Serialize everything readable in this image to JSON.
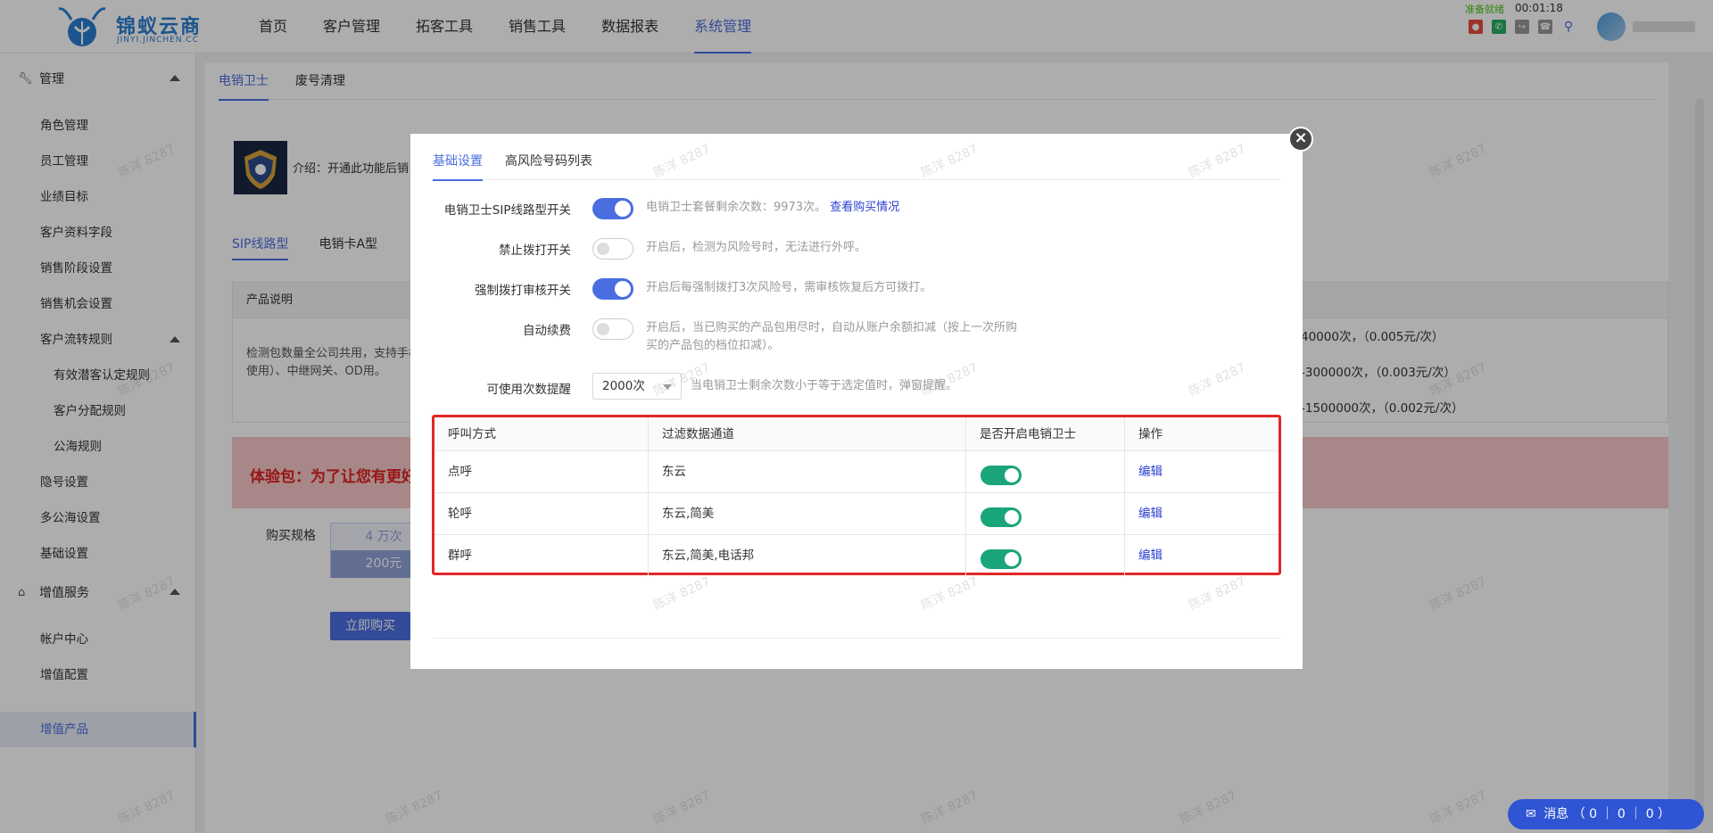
{
  "header": {
    "logo_title": "锦蚁云商",
    "logo_sub": "JINYI.JINCHEN.CC",
    "nav": [
      {
        "label": "首页",
        "active": false
      },
      {
        "label": "客户管理",
        "active": false
      },
      {
        "label": "拓客工具",
        "active": false
      },
      {
        "label": "销售工具",
        "active": false
      },
      {
        "label": "数据报表",
        "active": false
      },
      {
        "label": "系统管理",
        "active": true
      }
    ],
    "status_ready": "准备就绪",
    "status_time": "00:01:18"
  },
  "sidebar": {
    "group_manage": "管理",
    "role": "角色管理",
    "staff": "员工管理",
    "target": "业绩目标",
    "fields": "客户资料字段",
    "stage": "销售阶段设置",
    "opportunity": "销售机会设置",
    "flow": "客户流转规则",
    "flow_sub_1": "有效潜客认定规则",
    "flow_sub_2": "客户分配规则",
    "flow_sub_3": "公海规则",
    "hidden_number": "隐号设置",
    "multi_sea": "多公海设置",
    "basic": "基础设置",
    "group_value": "增值服务",
    "account": "帐户中心",
    "value_config": "增值配置",
    "value_product": "增值产品"
  },
  "main": {
    "tab_guard": "电销卫士",
    "tab_clean": "废号清理",
    "intro": "介绍：开通此功能后销",
    "subtab_sip": "SIP线路型",
    "subtab_card": "电销卡A型",
    "desc_head": "产品说明",
    "desc_body": "检测包数量全公司共用，支持手机卡使用）、中继网关、OD用。",
    "price_1": "40000次，（0.005元/次）",
    "price_2": "-300000次，（0.003元/次）",
    "price_3": "-1500000次，（0.002元/次）",
    "trial": "体验包：为了让您有更好的",
    "buy_label": "购买规格",
    "spec_top": "4 万次",
    "spec_bottom": "200元",
    "buy_button": "立即购买"
  },
  "modal": {
    "tab_basic": "基础设置",
    "tab_risk": "高风险号码列表",
    "close": "×",
    "rows": {
      "sip_label": "电销卫士SIP线路型开关",
      "sip_hint": "电销卫士套餐剩余次数：9973次。",
      "sip_link": "查看购买情况",
      "ban_label": "禁止拨打开关",
      "ban_hint": "开启后，检测为风险号时，无法进行外呼。",
      "force_label": "强制拨打审核开关",
      "force_hint": "开启后每强制拨打3次风险号，需审核恢复后方可拨打。",
      "renew_label": "自动续费",
      "renew_hint_1": "开启后，当已购买的产品包用尽时，自动从账户余额扣减（按上一次所购",
      "renew_hint_2": "买的产品包的档位扣减）。",
      "remind_label": "可使用次数提醒",
      "remind_value": "2000次",
      "remind_hint": "当电销卫士剩余次数小于等于选定值时，弹窗提醒。"
    },
    "table": {
      "headers": [
        "呼叫方式",
        "过滤数据通道",
        "是否开启电销卫士",
        "操作"
      ],
      "rows": [
        {
          "method": "点呼",
          "channel": "东云",
          "action": "编辑"
        },
        {
          "method": "轮呼",
          "channel": "东云,简美",
          "action": "编辑"
        },
        {
          "method": "群呼",
          "channel": "东云,简美,电话邦",
          "action": "编辑"
        }
      ]
    }
  },
  "message_bar": {
    "label": "消息",
    "text": "（ 0 ｜ 0 ｜ 0 ）"
  },
  "watermark": "陈洋 8287"
}
